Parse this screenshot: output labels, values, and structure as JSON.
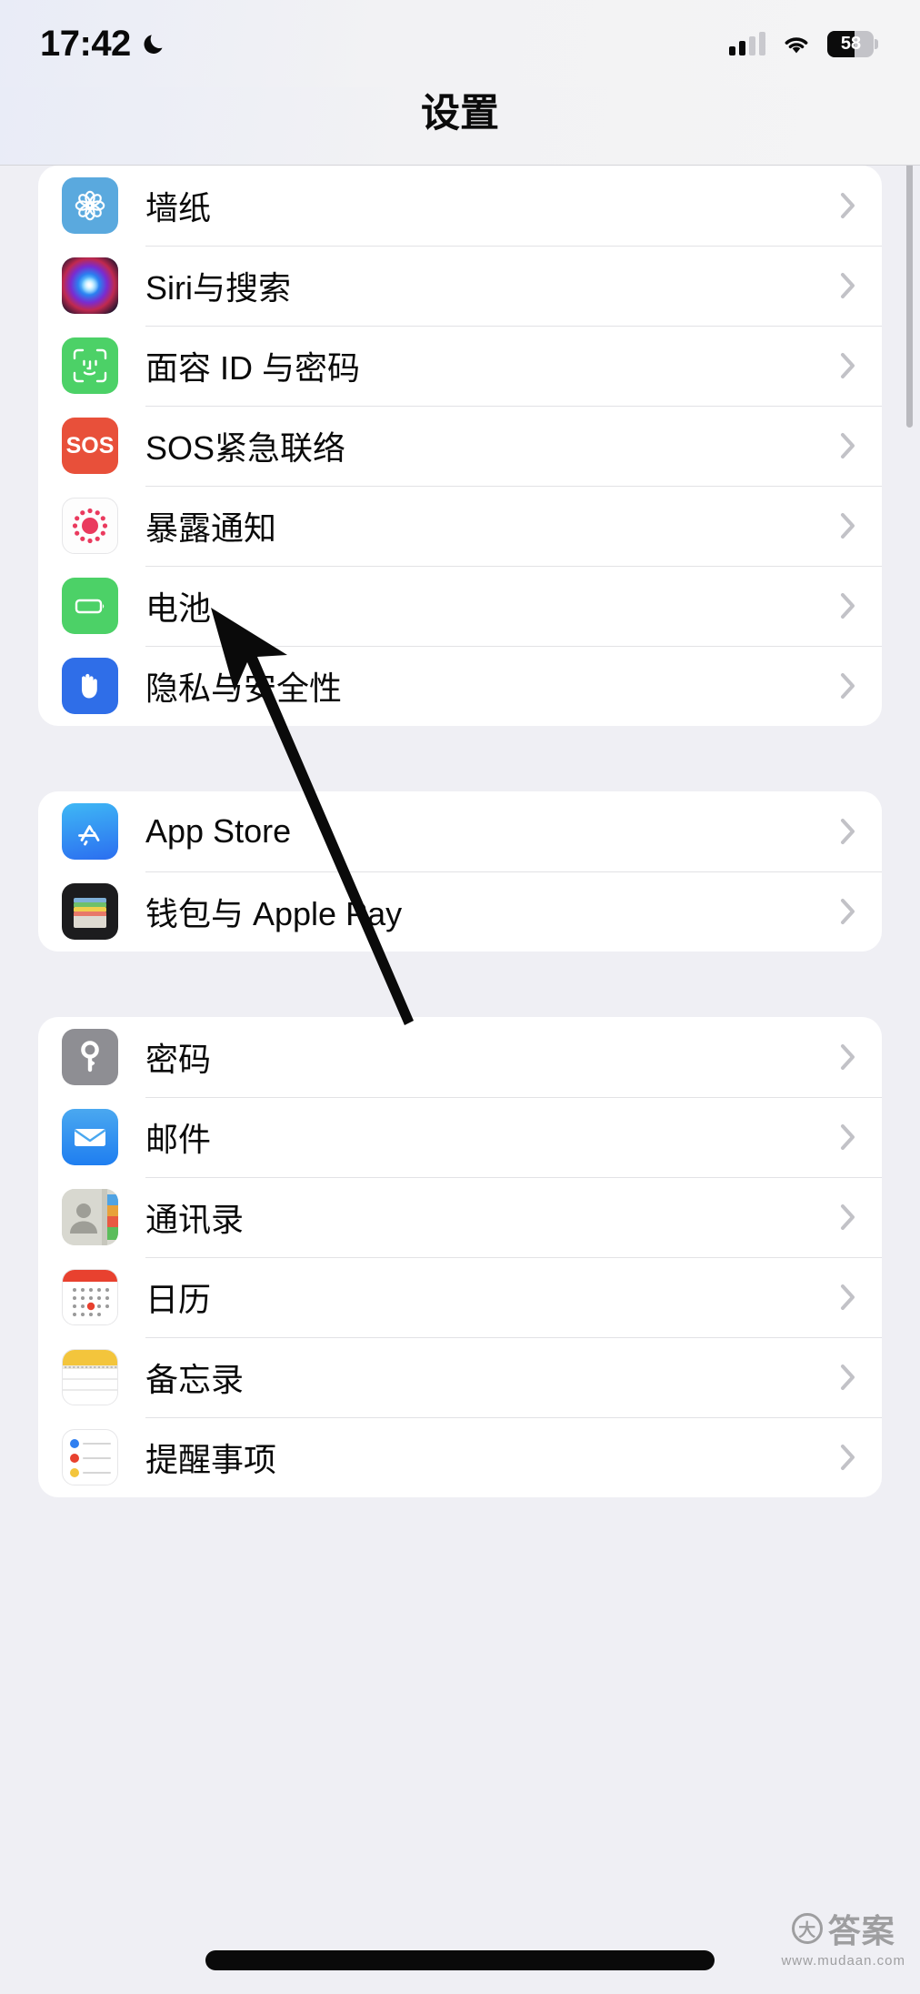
{
  "status_bar": {
    "time": "17:42",
    "focus_icon": "crescent-moon-icon",
    "signal_icon": "cellular-signal-icon",
    "signal_bars_filled": 2,
    "signal_bars_total": 4,
    "wifi_icon": "wifi-icon",
    "battery_icon": "battery-icon",
    "battery_percent": "58"
  },
  "nav": {
    "title": "设置"
  },
  "groups": [
    {
      "rows": [
        {
          "label": "墙纸",
          "icon": "wallpaper-icon",
          "chevron": "chevron-right-icon"
        },
        {
          "label": "Siri与搜索",
          "icon": "siri-icon",
          "chevron": "chevron-right-icon"
        },
        {
          "label": "面容 ID 与密码",
          "icon": "face-id-icon",
          "chevron": "chevron-right-icon"
        },
        {
          "label": "SOS紧急联络",
          "icon": "sos-icon",
          "chevron": "chevron-right-icon"
        },
        {
          "label": "暴露通知",
          "icon": "exposure-notifications-icon",
          "chevron": "chevron-right-icon"
        },
        {
          "label": "电池",
          "icon": "battery-settings-icon",
          "chevron": "chevron-right-icon"
        },
        {
          "label": "隐私与安全性",
          "icon": "privacy-hand-icon",
          "chevron": "chevron-right-icon"
        }
      ]
    },
    {
      "rows": [
        {
          "label": "App Store",
          "icon": "app-store-icon",
          "chevron": "chevron-right-icon"
        },
        {
          "label": "钱包与 Apple Pay",
          "icon": "wallet-icon",
          "chevron": "chevron-right-icon"
        }
      ]
    },
    {
      "rows": [
        {
          "label": "密码",
          "icon": "passwords-key-icon",
          "chevron": "chevron-right-icon"
        },
        {
          "label": "邮件",
          "icon": "mail-icon",
          "chevron": "chevron-right-icon"
        },
        {
          "label": "通讯录",
          "icon": "contacts-icon",
          "chevron": "chevron-right-icon"
        },
        {
          "label": "日历",
          "icon": "calendar-icon",
          "chevron": "chevron-right-icon"
        },
        {
          "label": "备忘录",
          "icon": "notes-icon",
          "chevron": "chevron-right-icon"
        },
        {
          "label": "提醒事项",
          "icon": "reminders-icon",
          "chevron": "chevron-right-icon"
        }
      ]
    }
  ],
  "sos_icon_text": "SOS",
  "watermark": {
    "mark": "大",
    "name": "答案",
    "url": "www.mudaan.com"
  },
  "colors": {
    "page_background": "#efeff4",
    "card_background": "#ffffff",
    "separator": "#e2e2e5",
    "label_text": "#0a0a0a",
    "chevron": "#c2c2c7",
    "green": "#4cd167",
    "red": "#e8503a",
    "blue": "#2f6ee8",
    "gray": "#8e8e93"
  }
}
